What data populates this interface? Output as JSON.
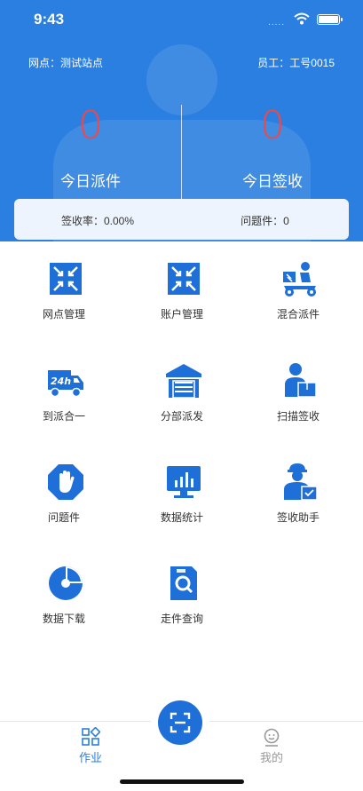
{
  "status_bar": {
    "time": "9:43",
    "signal": "....."
  },
  "header": {
    "site_label": "网点：测试站点",
    "staff_label": "员工：工号0015",
    "dispatch_count": "0",
    "dispatch_label": "今日派件",
    "sign_count": "0",
    "sign_label": "今日签收",
    "sign_rate": "签收率：0.00%",
    "problem_count": "问题件：0"
  },
  "menu": [
    {
      "label": "网点管理",
      "icon": "shrink-arrows-icon"
    },
    {
      "label": "账户管理",
      "icon": "shrink-arrows-icon"
    },
    {
      "label": "混合派件",
      "icon": "delivery-scooter-icon"
    },
    {
      "label": "到派合一",
      "icon": "truck-24h-icon"
    },
    {
      "label": "分部派发",
      "icon": "warehouse-icon"
    },
    {
      "label": "扫描签收",
      "icon": "courier-parcel-icon"
    },
    {
      "label": "问题件",
      "icon": "stop-hand-icon"
    },
    {
      "label": "数据统计",
      "icon": "monitor-chart-icon"
    },
    {
      "label": "签收助手",
      "icon": "assistant-icon"
    },
    {
      "label": "数据下载",
      "icon": "pie-download-icon"
    },
    {
      "label": "走件查询",
      "icon": "search-doc-icon"
    }
  ],
  "tabbar": {
    "work_label": "作业",
    "mine_label": "我的"
  },
  "colors": {
    "primary": "#2a7fe0",
    "accent_red": "#f04848",
    "icon_blue": "#1f6fd8"
  }
}
